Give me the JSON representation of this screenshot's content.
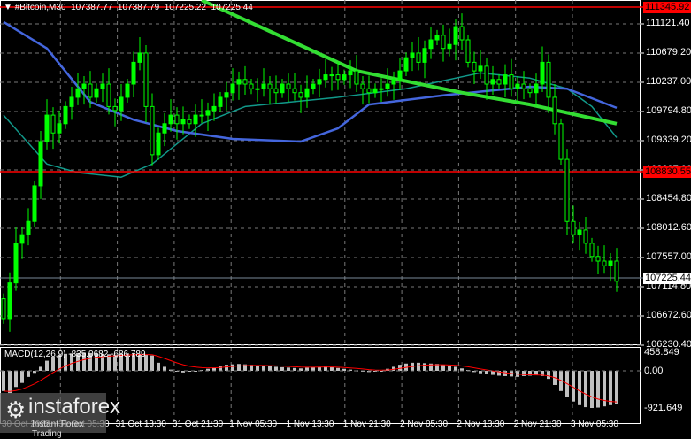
{
  "header": {
    "symbol": "#Bitcoin,M30",
    "open": "107387.77",
    "high": "107387.79",
    "low": "107225.22",
    "close": "107225.44"
  },
  "price_axis": [
    "111121.40",
    "110679.20",
    "110237.00",
    "109794.80",
    "109339.20",
    "108897.00",
    "108454.80",
    "108012.60",
    "107557.00",
    "107114.80",
    "106672.60",
    "106230.40"
  ],
  "price_lines": {
    "resistance": "111345.92",
    "support": "108830.55",
    "current": "107225.44"
  },
  "macd": {
    "label": "MACD(12,26,9) -835.0682 -686.789",
    "axis": [
      "458.849",
      "0.00",
      "-921.649"
    ]
  },
  "time_axis": [
    "30 Oct 2025",
    "31 Oct 05:30",
    "31 Oct 13:30",
    "31 Oct 21:30",
    "1 Nov 05:30",
    "1 Nov 13:30",
    "1 Nov 21:30",
    "2 Nov 05:30",
    "2 Nov 13:30",
    "2 Nov 21:30",
    "3 Nov 05:30"
  ],
  "watermark": {
    "brand": "instaforex",
    "tagline": "Instant Forex Trading"
  },
  "colors": {
    "candle": "#00ff00",
    "ma_slow": "#33dd33",
    "ma_mid": "#4466dd",
    "ma_fast": "#11998a",
    "level": "#ff0000",
    "macd_hist": "#c0c0c0",
    "macd_signal": "#ff0000"
  },
  "chart_data": {
    "type": "candlestick",
    "ylim": [
      106230.4,
      111345.92
    ],
    "closes": [
      106660,
      107200,
      107800,
      107930,
      108130,
      108670,
      109340,
      109740,
      109470,
      109610,
      109870,
      110010,
      110140,
      110210,
      110010,
      110140,
      110210,
      109870,
      109810,
      110010,
      110210,
      110540,
      110680,
      109870,
      109140,
      109470,
      109610,
      109740,
      109610,
      109670,
      109610,
      109740,
      109740,
      109810,
      109870,
      110010,
      110080,
      110210,
      110280,
      110210,
      110140,
      110140,
      110210,
      110140,
      110080,
      110210,
      110140,
      110080,
      110010,
      110140,
      110210,
      110280,
      110350,
      110350,
      110280,
      110350,
      110410,
      110210,
      110140,
      110080,
      110140,
      110140,
      110210,
      110280,
      110410,
      110610,
      110680,
      110540,
      110750,
      110880,
      110950,
      110750,
      110810,
      111080,
      110880,
      110540,
      110410,
      110480,
      110210,
      110280,
      110210,
      110350,
      110140,
      110210,
      110140,
      110080,
      110210,
      110540,
      110010,
      109610,
      109070,
      108130,
      107930,
      108000,
      107800,
      107600,
      107530,
      107460,
      107530,
      107225
    ],
    "ma_slow": [
      [
        32,
        111480
      ],
      [
        57,
        110410
      ],
      [
        74,
        110080
      ],
      [
        85,
        109900
      ],
      [
        99,
        109610
      ]
    ],
    "ma_mid": [
      [
        0,
        111150
      ],
      [
        7,
        110750
      ],
      [
        14,
        109940
      ],
      [
        21,
        109670
      ],
      [
        28,
        109500
      ],
      [
        37,
        109380
      ],
      [
        48,
        109340
      ],
      [
        54,
        109540
      ],
      [
        59,
        109900
      ],
      [
        71,
        110040
      ],
      [
        85,
        110170
      ],
      [
        91,
        110140
      ],
      [
        99,
        109850
      ]
    ],
    "ma_fast": [
      [
        0,
        109740
      ],
      [
        7,
        109000
      ],
      [
        12,
        108870
      ],
      [
        19,
        108800
      ],
      [
        24,
        109000
      ],
      [
        32,
        109610
      ],
      [
        39,
        109870
      ],
      [
        54,
        110010
      ],
      [
        65,
        110140
      ],
      [
        77,
        110380
      ],
      [
        85,
        110300
      ],
      [
        91,
        110140
      ],
      [
        95,
        109870
      ],
      [
        99,
        109400
      ]
    ],
    "macd_hist": [
      -500,
      -550,
      -400,
      -300,
      -150,
      -50,
      100,
      250,
      350,
      400,
      420,
      430,
      440,
      450,
      440,
      430,
      420,
      410,
      400,
      420,
      430,
      440,
      420,
      400,
      380,
      200,
      100,
      30,
      -20,
      -40,
      -20,
      0,
      20,
      50,
      80,
      120,
      150,
      160,
      170,
      160,
      150,
      140,
      130,
      110,
      100,
      90,
      80,
      70,
      60,
      80,
      90,
      100,
      110,
      90,
      70,
      50,
      30,
      10,
      -10,
      -30,
      -20,
      0,
      50,
      100,
      150,
      180,
      200,
      200,
      190,
      180,
      170,
      150,
      120,
      100,
      60,
      20,
      -30,
      -60,
      -80,
      -100,
      -120,
      -130,
      -140,
      -150,
      -130,
      -120,
      -110,
      -130,
      -200,
      -350,
      -500,
      -650,
      -760,
      -850,
      -900,
      -920,
      -910,
      -880,
      -850,
      -820
    ],
    "macd_ylim": [
      -921.649,
      458.849
    ]
  }
}
